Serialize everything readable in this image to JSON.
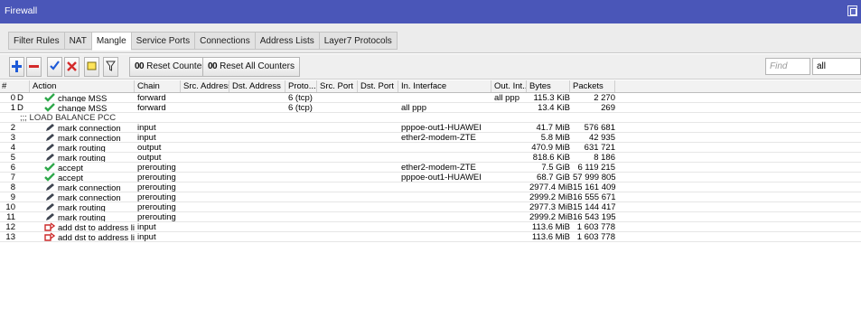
{
  "window": {
    "title": "Firewall"
  },
  "tabs": [
    {
      "label": "Filter Rules",
      "active": false
    },
    {
      "label": "NAT",
      "active": false
    },
    {
      "label": "Mangle",
      "active": true
    },
    {
      "label": "Service Ports",
      "active": false
    },
    {
      "label": "Connections",
      "active": false
    },
    {
      "label": "Address Lists",
      "active": false
    },
    {
      "label": "Layer7 Protocols",
      "active": false
    }
  ],
  "toolbar": {
    "add_icon": "plus-icon",
    "remove_icon": "minus-icon",
    "enable_icon": "checkmark-icon",
    "disable_icon": "x-icon",
    "comment_icon": "note-icon",
    "filter_icon": "funnel-icon",
    "reset_counters_prefix": "00",
    "reset_counters_label": "Reset Counters",
    "reset_all_counters_prefix": "00",
    "reset_all_counters_label": "Reset All Counters",
    "find_placeholder": "Find",
    "filter_value": "all"
  },
  "columns": [
    "#",
    "Action",
    "Chain",
    "Src. Address",
    "Dst. Address",
    "Proto...",
    "Src. Port",
    "Dst. Port",
    "In. Interface",
    "Out. Int...",
    "Bytes",
    "Packets"
  ],
  "rows": [
    {
      "num": "0",
      "flag": "D",
      "icon": "accept",
      "action": "change MSS",
      "chain": "forward",
      "src": "",
      "dst": "",
      "proto": "6 (tcp)",
      "sport": "",
      "dport": "",
      "in": "",
      "out": "all ppp",
      "bytes": "115.3 KiB",
      "packets": "2 270"
    },
    {
      "num": "1",
      "flag": "D",
      "icon": "accept",
      "action": "change MSS",
      "chain": "forward",
      "src": "",
      "dst": "",
      "proto": "6 (tcp)",
      "sport": "",
      "dport": "",
      "in": "all ppp",
      "out": "",
      "bytes": "13.4 KiB",
      "packets": "269"
    },
    {
      "comment": ";;; LOAD BALANCE PCC"
    },
    {
      "num": "2",
      "flag": "",
      "icon": "mark",
      "action": "mark connection",
      "chain": "input",
      "src": "",
      "dst": "",
      "proto": "",
      "sport": "",
      "dport": "",
      "in": "pppoe-out1-HUAWEI",
      "out": "",
      "bytes": "41.7 MiB",
      "packets": "576 681"
    },
    {
      "num": "3",
      "flag": "",
      "icon": "mark",
      "action": "mark connection",
      "chain": "input",
      "src": "",
      "dst": "",
      "proto": "",
      "sport": "",
      "dport": "",
      "in": "ether2-modem-ZTE",
      "out": "",
      "bytes": "5.8 MiB",
      "packets": "42 935"
    },
    {
      "num": "4",
      "flag": "",
      "icon": "mark",
      "action": "mark routing",
      "chain": "output",
      "src": "",
      "dst": "",
      "proto": "",
      "sport": "",
      "dport": "",
      "in": "",
      "out": "",
      "bytes": "470.9 MiB",
      "packets": "631 721"
    },
    {
      "num": "5",
      "flag": "",
      "icon": "mark",
      "action": "mark routing",
      "chain": "output",
      "src": "",
      "dst": "",
      "proto": "",
      "sport": "",
      "dport": "",
      "in": "",
      "out": "",
      "bytes": "818.6 KiB",
      "packets": "8 186"
    },
    {
      "num": "6",
      "flag": "",
      "icon": "accept",
      "action": "accept",
      "chain": "prerouting",
      "src": "",
      "dst": "",
      "proto": "",
      "sport": "",
      "dport": "",
      "in": "ether2-modem-ZTE",
      "out": "",
      "bytes": "7.5 GiB",
      "packets": "6 119 215"
    },
    {
      "num": "7",
      "flag": "",
      "icon": "accept",
      "action": "accept",
      "chain": "prerouting",
      "src": "",
      "dst": "",
      "proto": "",
      "sport": "",
      "dport": "",
      "in": "pppoe-out1-HUAWEI",
      "out": "",
      "bytes": "68.7 GiB",
      "packets": "57 999 805"
    },
    {
      "num": "8",
      "flag": "",
      "icon": "mark",
      "action": "mark connection",
      "chain": "prerouting",
      "src": "",
      "dst": "",
      "proto": "",
      "sport": "",
      "dport": "",
      "in": "",
      "out": "",
      "bytes": "2977.4 MiB",
      "packets": "15 161 409"
    },
    {
      "num": "9",
      "flag": "",
      "icon": "mark",
      "action": "mark connection",
      "chain": "prerouting",
      "src": "",
      "dst": "",
      "proto": "",
      "sport": "",
      "dport": "",
      "in": "",
      "out": "",
      "bytes": "2999.2 MiB",
      "packets": "16 555 671"
    },
    {
      "num": "10",
      "flag": "",
      "icon": "mark",
      "action": "mark routing",
      "chain": "prerouting",
      "src": "",
      "dst": "",
      "proto": "",
      "sport": "",
      "dport": "",
      "in": "",
      "out": "",
      "bytes": "2977.3 MiB",
      "packets": "15 144 417"
    },
    {
      "num": "11",
      "flag": "",
      "icon": "mark",
      "action": "mark routing",
      "chain": "prerouting",
      "src": "",
      "dst": "",
      "proto": "",
      "sport": "",
      "dport": "",
      "in": "",
      "out": "",
      "bytes": "2999.2 MiB",
      "packets": "16 543 195"
    },
    {
      "num": "12",
      "flag": "",
      "icon": "addlist",
      "action": "add dst to address list",
      "chain": "input",
      "src": "",
      "dst": "",
      "proto": "",
      "sport": "",
      "dport": "",
      "in": "",
      "out": "",
      "bytes": "113.6 MiB",
      "packets": "1 603 778"
    },
    {
      "num": "13",
      "flag": "",
      "icon": "addlist",
      "action": "add dst to address list",
      "chain": "input",
      "src": "",
      "dst": "",
      "proto": "",
      "sport": "",
      "dport": "",
      "in": "",
      "out": "",
      "bytes": "113.6 MiB",
      "packets": "1 603 778"
    }
  ],
  "colors": {
    "titlebar": "#4a56b8",
    "accept_icon": "#2ea84a",
    "mark_icon": "#3d4450",
    "addlist_icon": "#cc2a2a",
    "add_icon": "#1e5bd8",
    "remove_icon": "#d42b2b"
  }
}
